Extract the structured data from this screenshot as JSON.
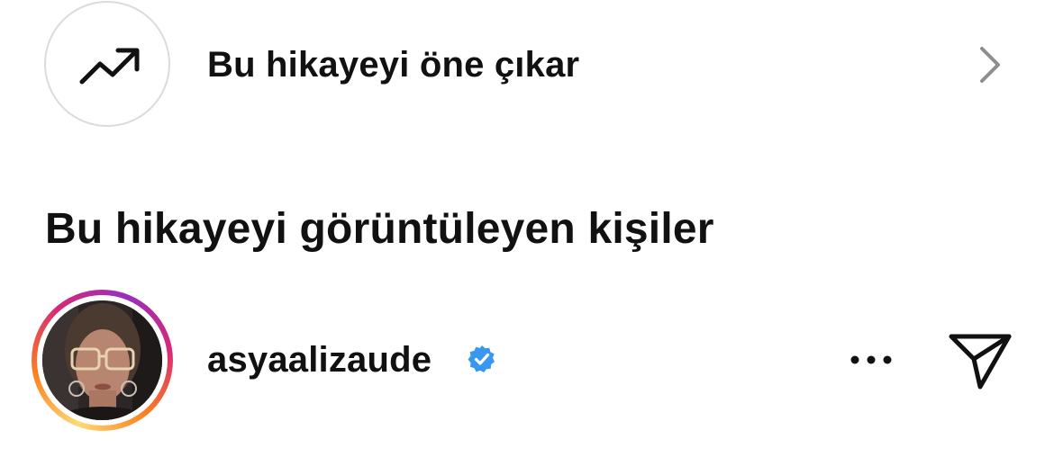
{
  "boost": {
    "label": "Bu hikayeyi öne çıkar",
    "icon": "trending-up-icon"
  },
  "viewers_section": {
    "title": "Bu hikayeyi görüntüleyen kişiler"
  },
  "viewers": [
    {
      "username": "asyaalizaude",
      "verified": true,
      "has_story_ring": true
    }
  ],
  "colors": {
    "text": "#111111",
    "border": "#dbdbdb",
    "chevron": "#8e8e8e",
    "verified_blue": "#3897f0",
    "story_ring": [
      "#feda75",
      "#fa7e1e",
      "#d62976",
      "#962fbf"
    ]
  }
}
